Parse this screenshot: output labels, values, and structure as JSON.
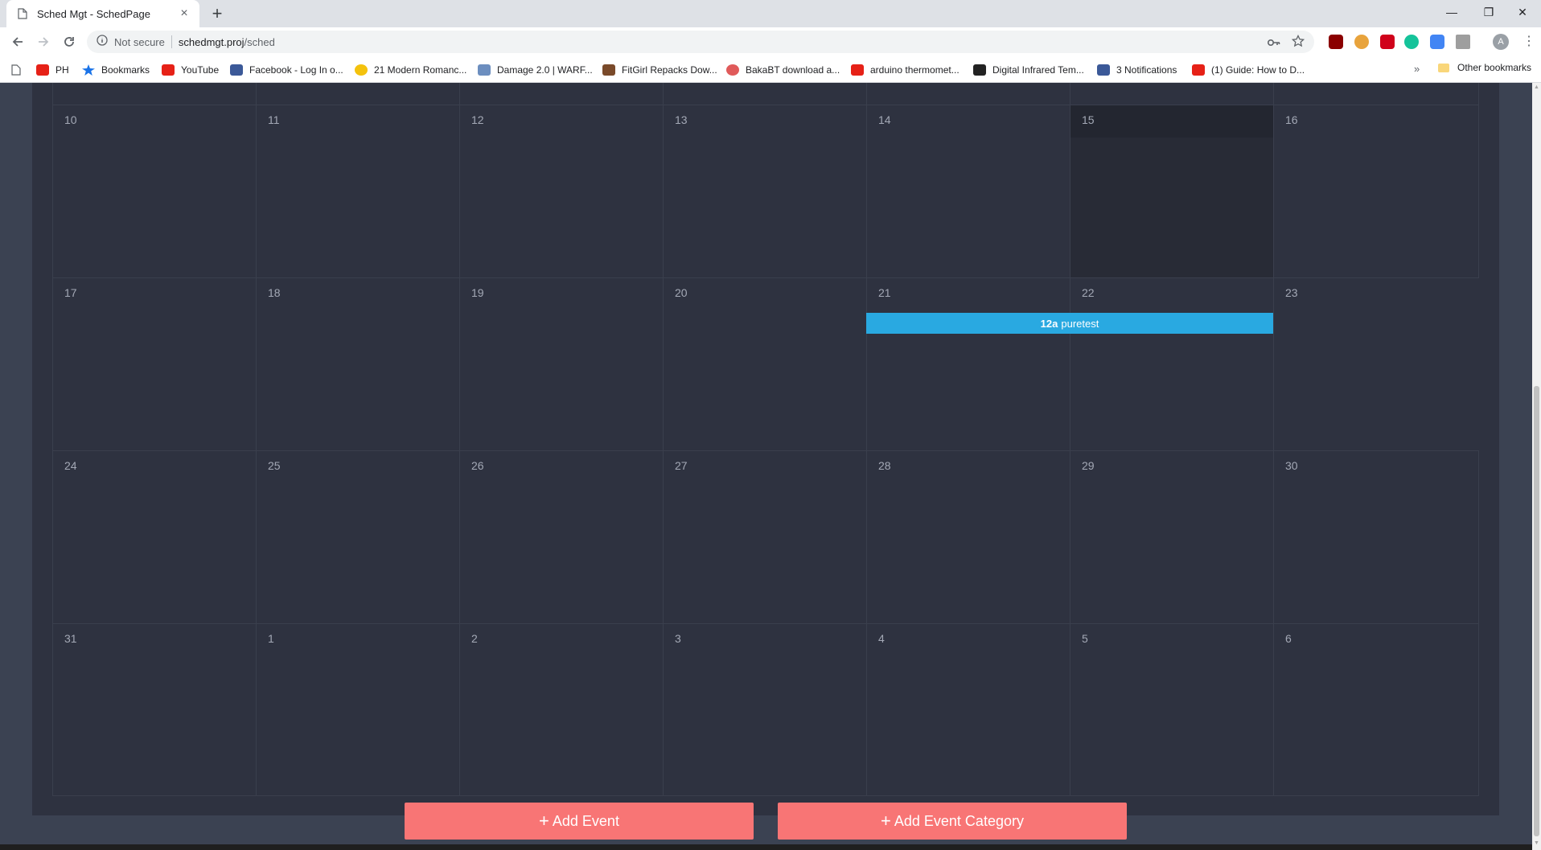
{
  "browser": {
    "tab_title": "Sched Mgt - SchedPage",
    "tab_close": "×",
    "new_tab": "+",
    "security_label": "Not secure",
    "url_host": "schedmgt.proj",
    "url_path": "/sched",
    "avatar_initial": "A",
    "window_controls": {
      "minimize": "—",
      "restore": "❐",
      "close": "✕"
    },
    "bookmarks": [
      {
        "label": "PH",
        "icon": "youtube-icon",
        "color": "#e62117"
      },
      {
        "label": "Bookmarks",
        "icon": "star-icon",
        "color": "#1a73e8"
      },
      {
        "label": "YouTube",
        "icon": "youtube-icon",
        "color": "#e62117"
      },
      {
        "label": "Facebook - Log In o...",
        "icon": "facebook-icon",
        "color": "#3b5998"
      },
      {
        "label": "21 Modern Romanc...",
        "icon": "smiley-icon",
        "color": "#f4c20d"
      },
      {
        "label": "Damage 2.0 | WARF...",
        "icon": "site-icon",
        "color": "#6c8ebf"
      },
      {
        "label": "FitGirl Repacks Dow...",
        "icon": "site-icon",
        "color": "#7a4a2a"
      },
      {
        "label": "BakaBT download a...",
        "icon": "site-icon",
        "color": "#e05a5a"
      },
      {
        "label": "arduino thermomet...",
        "icon": "youtube-icon",
        "color": "#e62117"
      },
      {
        "label": "Digital Infrared Tem...",
        "icon": "site-icon",
        "color": "#222222"
      },
      {
        "label": "3 Notifications",
        "icon": "facebook-icon",
        "color": "#3b5998"
      },
      {
        "label": "(1) Guide: How to D...",
        "icon": "youtube-icon",
        "color": "#e62117"
      }
    ],
    "bookmarks_more": "»",
    "other_bookmarks": "Other bookmarks"
  },
  "calendar": {
    "weeks": [
      [
        "10",
        "11",
        "12",
        "13",
        "14",
        "15",
        "16"
      ],
      [
        "17",
        "18",
        "19",
        "20",
        "21",
        "22",
        "23"
      ],
      [
        "24",
        "25",
        "26",
        "27",
        "28",
        "29",
        "30"
      ],
      [
        "31",
        "1",
        "2",
        "3",
        "4",
        "5",
        "6"
      ]
    ],
    "today": "15",
    "event": {
      "time": "12a",
      "title": "puretest",
      "color": "#29a9e1"
    }
  },
  "actions": {
    "add_event": "Add Event",
    "add_event_category": "Add Event Category",
    "plus": "+"
  },
  "colors": {
    "page_bg": "#3b4252",
    "calendar_bg": "#2e3240",
    "button": "#f87575",
    "event": "#29a9e1"
  }
}
